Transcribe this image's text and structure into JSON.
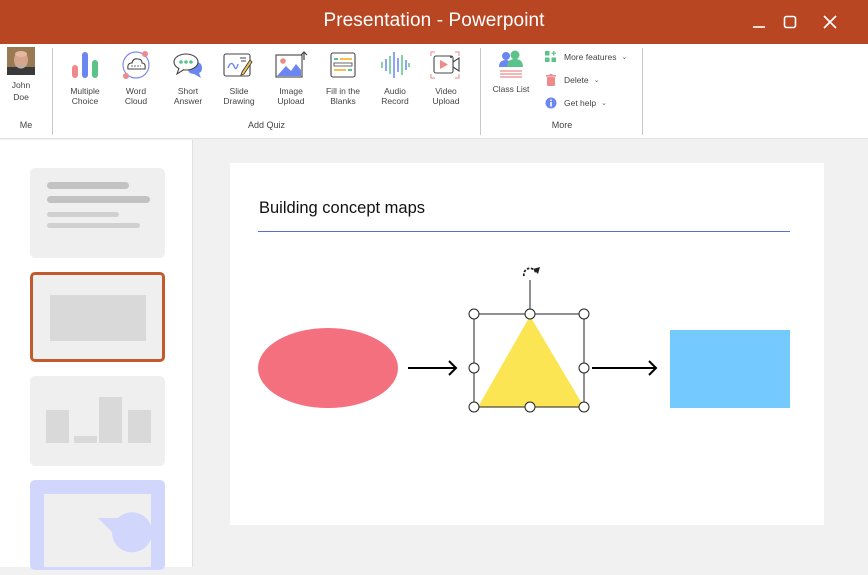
{
  "window": {
    "title": "Presentation - Powerpoint",
    "controls": [
      "minimize",
      "maximize",
      "close"
    ]
  },
  "ribbon": {
    "me": {
      "first_name": "John",
      "last_name": "Doe",
      "group_label": "Me"
    },
    "add_quiz": {
      "group_label": "Add Quiz",
      "buttons": [
        {
          "line1": "Multiple",
          "line2": "Choice",
          "icon": "bar-chart-icon"
        },
        {
          "line1": "Word",
          "line2": "Cloud",
          "icon": "word-cloud-icon"
        },
        {
          "line1": "Short",
          "line2": "Answer",
          "icon": "chat-bubble-icon"
        },
        {
          "line1": "Slide",
          "line2": "Drawing",
          "icon": "drawing-pen-icon"
        },
        {
          "line1": "Image",
          "line2": "Upload",
          "icon": "image-upload-icon"
        },
        {
          "line1": "Fill in the",
          "line2": "Blanks",
          "icon": "fill-blanks-icon"
        },
        {
          "line1": "Audio",
          "line2": "Record",
          "icon": "audio-wave-icon"
        },
        {
          "line1": "Video",
          "line2": "Upload",
          "icon": "video-camera-icon"
        }
      ]
    },
    "more": {
      "group_label": "More",
      "class_list": "Class List",
      "items": [
        {
          "label": "More features",
          "icon": "apps-plus-icon"
        },
        {
          "label": "Delete",
          "icon": "trash-icon"
        },
        {
          "label": "Get help",
          "icon": "info-icon"
        }
      ]
    }
  },
  "slides_panel": {
    "thumbnails": [
      {
        "kind": "text",
        "selected": false
      },
      {
        "kind": "image",
        "selected": true
      },
      {
        "kind": "bar-chart",
        "selected": false
      },
      {
        "kind": "pie-chart",
        "selected": false
      }
    ]
  },
  "slide": {
    "title": "Building concept maps",
    "shapes": [
      {
        "type": "ellipse",
        "color": "#f5707e"
      },
      {
        "type": "arrow"
      },
      {
        "type": "triangle",
        "color": "#fce553",
        "selected": true
      },
      {
        "type": "arrow"
      },
      {
        "type": "rectangle",
        "color": "#74cafe"
      }
    ]
  },
  "colors": {
    "titlebar": "#b94622",
    "selection_accent": "#c35a2e",
    "title_rule": "#5a6fd6"
  }
}
